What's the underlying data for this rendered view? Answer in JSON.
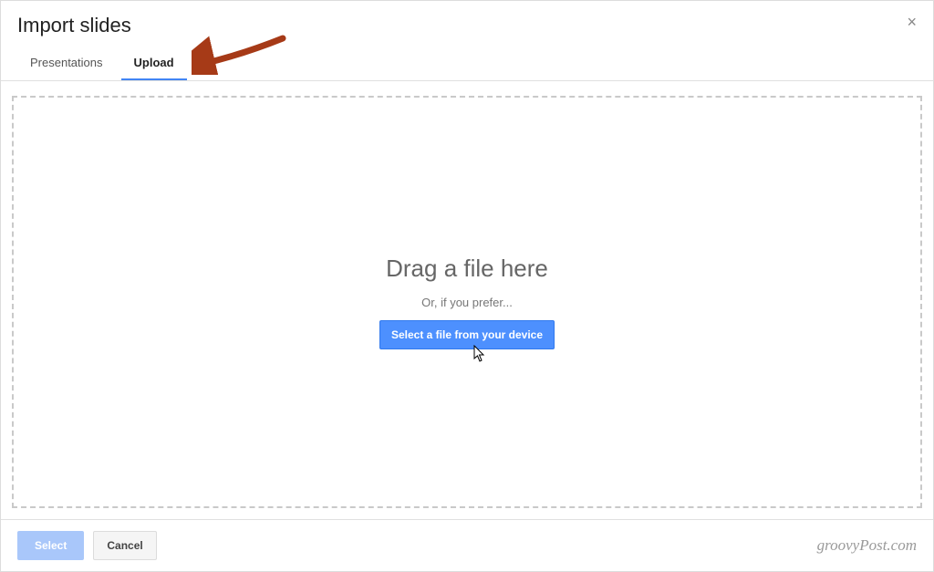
{
  "dialog": {
    "title": "Import slides",
    "close_symbol": "×"
  },
  "tabs": {
    "items": [
      {
        "label": "Presentations",
        "active": false
      },
      {
        "label": "Upload",
        "active": true
      }
    ]
  },
  "dropzone": {
    "drag_text": "Drag a file here",
    "or_text": "Or, if you prefer...",
    "select_file_label": "Select a file from your device"
  },
  "footer": {
    "select_label": "Select",
    "cancel_label": "Cancel",
    "watermark": "groovyPost.com"
  },
  "annotation": {
    "arrow_color": "#a63a17"
  }
}
